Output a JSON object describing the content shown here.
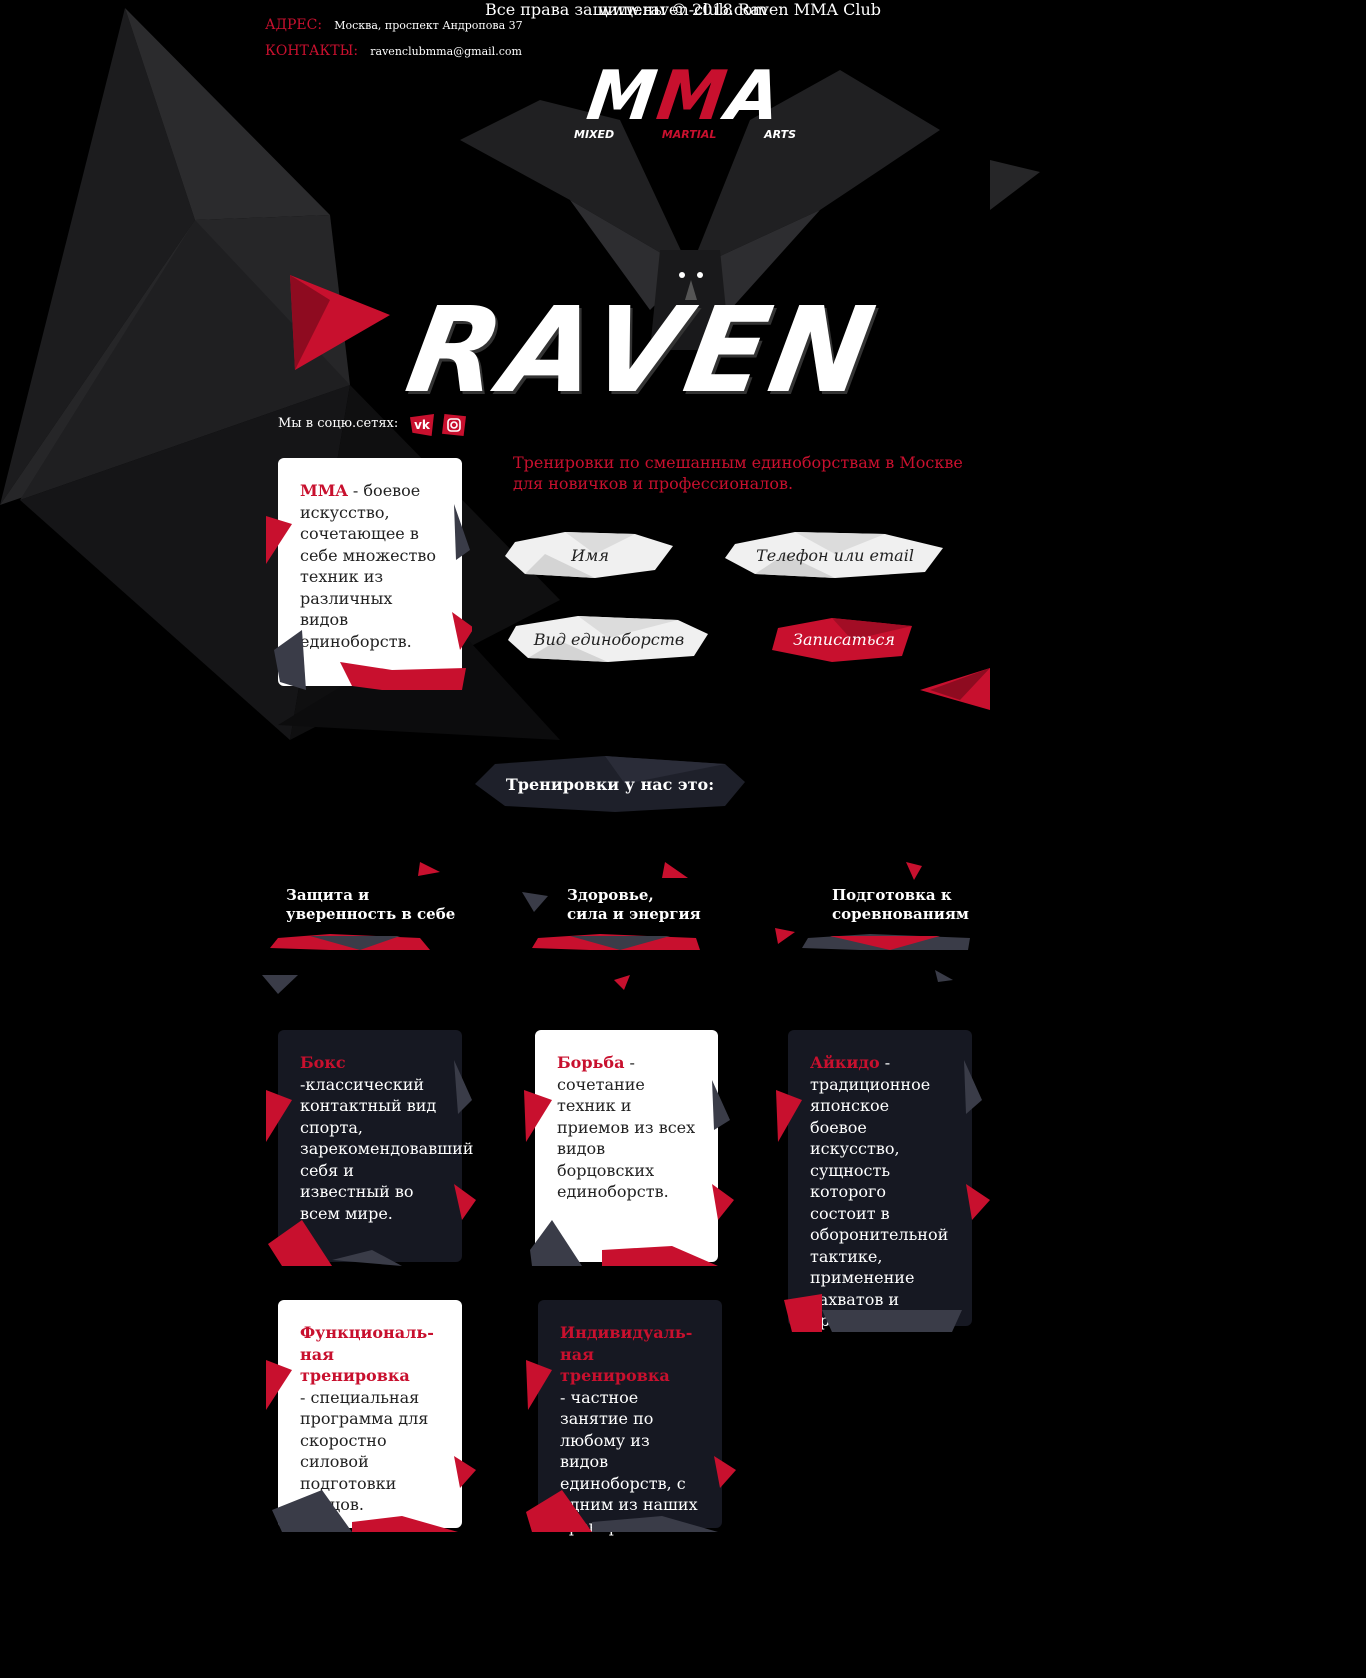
{
  "header": {
    "address_label": "АДРЕС:",
    "address_value": "Москва, проспект Андропова 37",
    "contacts_label": "КОНТАКТЫ:",
    "contacts_value": "ravenclubmma@gmail.com"
  },
  "logo": {
    "mma_part1": "M",
    "mma_part2": "M",
    "mma_part3": "A",
    "sub_mixed": "MIXED",
    "sub_martial": "MARTIAL",
    "sub_arts": "ARTS",
    "raven": "RAVEN"
  },
  "social": {
    "label": "Мы в соцю.сетях:",
    "vk_icon": "vk-icon",
    "instagram_icon": "instagram-icon"
  },
  "mma_card": {
    "term": "MMA",
    "text": " - боевое искусство, сочетающее в себе множество техник из различных видов единоборств."
  },
  "intro": "Тренировки по смешанным единоборствам в Москве для новичков и профессионалов.",
  "form": {
    "name_placeholder": "Имя",
    "contact_placeholder": "Телефон или email",
    "sport_placeholder": "Вид единоборств",
    "submit_label": "Записаться"
  },
  "section_title": "Тренировки у нас это:",
  "benefits": [
    "Защита и\nуверенность в себе",
    "Здоровье,\nсила и энергия",
    "Подготовка к\nсоревнованиям"
  ],
  "disciplines": [
    {
      "term": "Бокс",
      "text": "-классический контактный вид спорта, зарекомендовавший себя и известный во всем мире."
    },
    {
      "term": "Борьба",
      "text": " - сочетание техник и приемов из всех видов борцовских единоборств."
    },
    {
      "term": "Айкидо",
      "text": " - традиционное японское боевое искусство, сущность которого состоит в оборонительной тактике, применение захватов и бросков."
    },
    {
      "term": "Функциональ-ная тренировка",
      "text": "- специальная программа для скоростно силовой подготовки бойцов."
    },
    {
      "term": "Индивидуаль-ная тренировка",
      "text": "- частное занятие по любому из видов единоборств, с одним из наших тренеров."
    }
  ],
  "footer": {
    "copyright": "Все права защищены © 2018 Raven MMA Club",
    "site": "www.raven-club.com"
  },
  "colors": {
    "accent": "#c8102e",
    "background": "#000000",
    "card_dark": "#161822"
  }
}
